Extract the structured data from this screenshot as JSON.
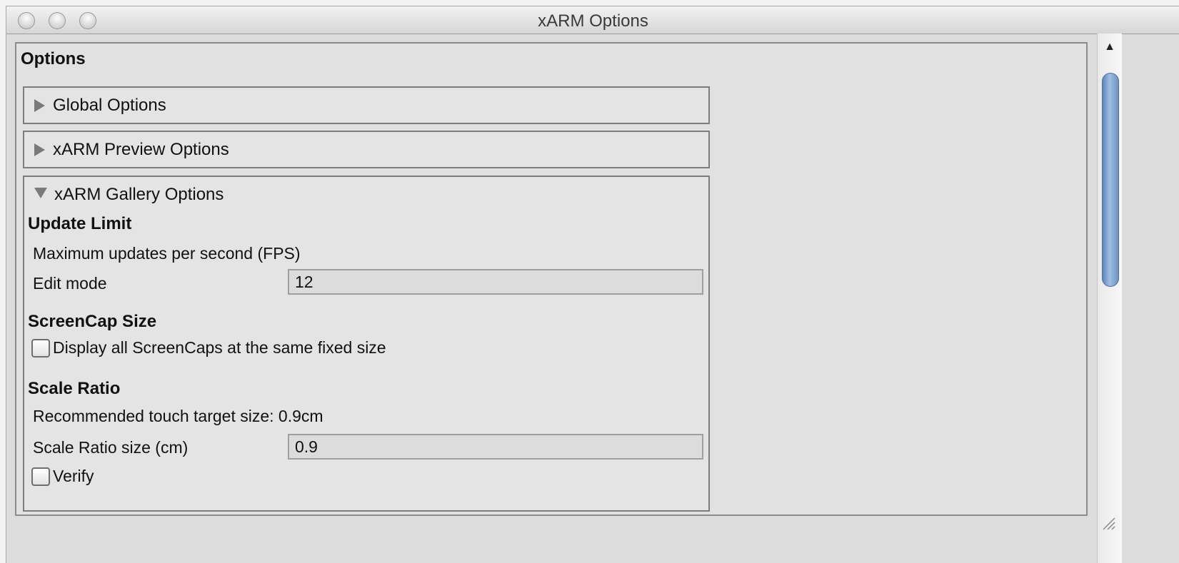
{
  "window": {
    "title": "xARM Options"
  },
  "options": {
    "heading": "Options",
    "global_options": "Global Options",
    "preview_options": "xARM Preview Options",
    "gallery_options": "xARM Gallery Options"
  },
  "gallery": {
    "update_limit": {
      "title": "Update Limit",
      "description": "Maximum updates per second (FPS)",
      "edit_mode_label": "Edit mode",
      "edit_mode_value": "12"
    },
    "screencap_size": {
      "title": "ScreenCap Size",
      "fixed_size_label": "Display all ScreenCaps at the same fixed size",
      "fixed_size_checked": false
    },
    "scale_ratio": {
      "title": "Scale Ratio",
      "recommendation": "Recommended touch target size: 0.9cm",
      "size_label": "Scale Ratio size (cm)",
      "size_value": "0.9",
      "verify_label": "Verify",
      "verify_checked": false
    }
  },
  "icons": {
    "scroll_up": "arrow-up-icon",
    "collapsed": "triangle-right-icon",
    "expanded": "triangle-down-icon",
    "resize": "resize-grip-icon"
  },
  "colors": {
    "scroll_thumb": "#7aa0d0",
    "panel_bg": "#e1e1e1",
    "window_bg": "#dcdcdc"
  }
}
